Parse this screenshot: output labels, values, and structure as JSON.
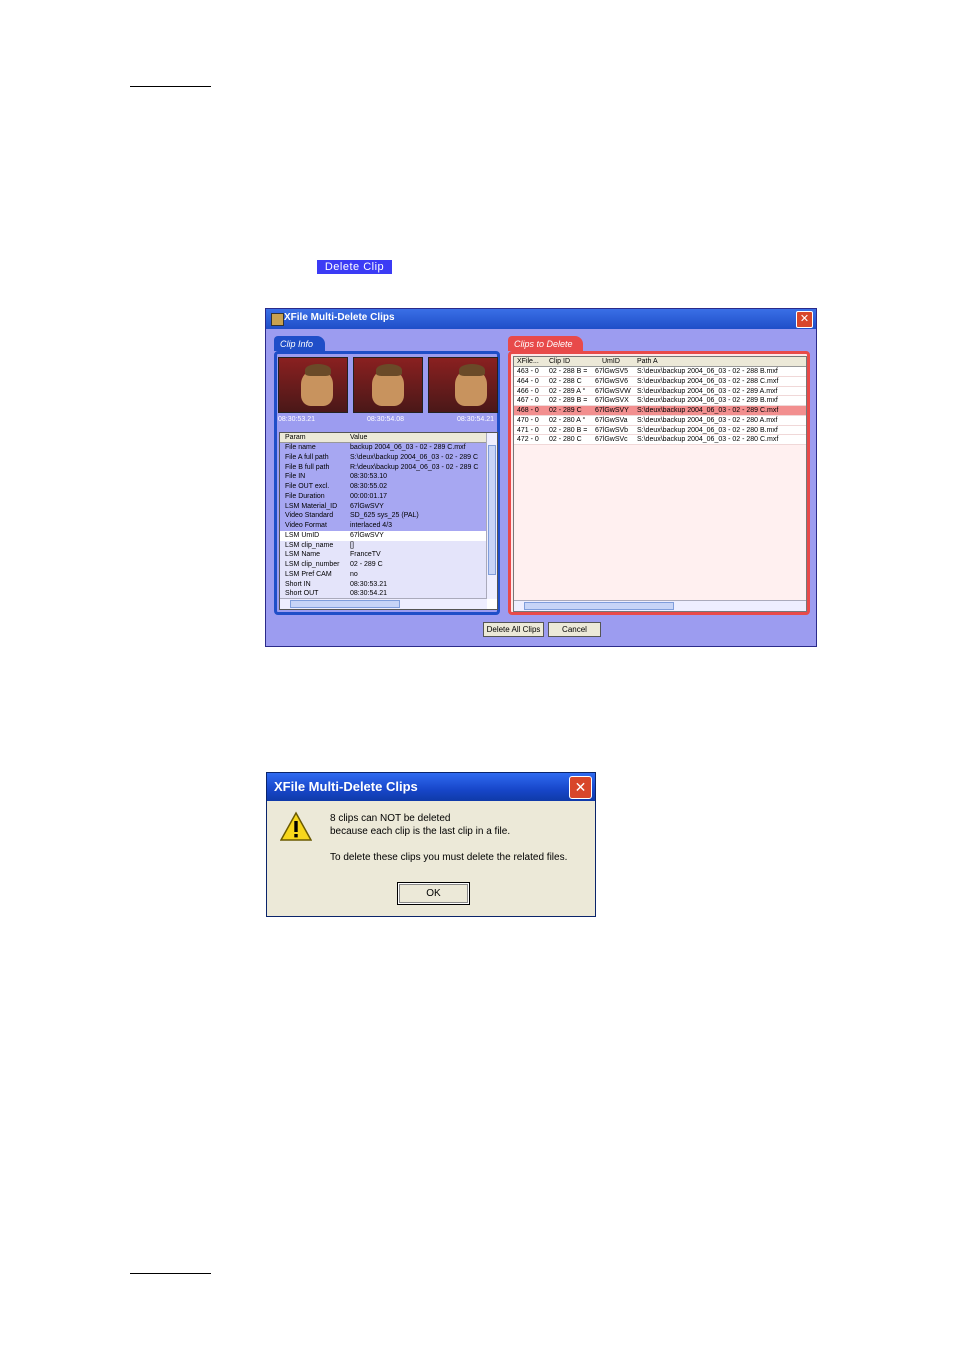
{
  "inline_button": {
    "label": "Delete Clip"
  },
  "main_window": {
    "title": "XFile Multi-Delete Clips",
    "clip_info": {
      "tab": "Clip Info",
      "timecodes": [
        "08:30:53.21",
        "08:30:54.08",
        "08:30:54.21"
      ],
      "columns": [
        "Param",
        "Value"
      ],
      "rows": [
        {
          "param": "File name",
          "value": "backup 2004_06_03 - 02 - 289 C.mxf"
        },
        {
          "param": "File A full path",
          "value": "S:\\deux\\backup 2004_06_03 - 02 - 289 C"
        },
        {
          "param": "File B full path",
          "value": "R:\\deux\\backup 2004_06_03 - 02 - 289 C"
        },
        {
          "param": "File IN",
          "value": "08:30:53.10"
        },
        {
          "param": "File OUT excl.",
          "value": "08:30:55.02"
        },
        {
          "param": "File Duration",
          "value": "00:00:01.17"
        },
        {
          "param": "LSM Material_ID",
          "value": "67lGwSVY"
        },
        {
          "param": "Video Standard",
          "value": "SD_625 sys_25 (PAL)"
        },
        {
          "param": "Video Format",
          "value": "interlaced 4/3"
        },
        {
          "param": "LSM UmID",
          "value": "67lGwSVY"
        },
        {
          "param": "LSM clip_name",
          "value": "[]"
        },
        {
          "param": "LSM Name",
          "value": "FranceTV"
        },
        {
          "param": "LSM clip_number",
          "value": "02 - 289 C"
        },
        {
          "param": "LSM Pref CAM",
          "value": "no"
        },
        {
          "param": "Short IN",
          "value": "08:30:53.21"
        },
        {
          "param": "Short OUT",
          "value": "08:30:54.21"
        }
      ]
    },
    "clips_to_delete": {
      "tab": "Clips to Delete",
      "columns": [
        "XFile...",
        "Clip ID",
        "UmID",
        "Path A"
      ],
      "rows": [
        {
          "xfile": "463 - 0",
          "clip_id": "02 - 288 B =",
          "umid": "67lGwSV5",
          "path": "S:\\deux\\backup 2004_06_03 - 02 - 288 B.mxf"
        },
        {
          "xfile": "464 - 0",
          "clip_id": "02 - 288 C",
          "umid": "67lGwSV6",
          "path": "S:\\deux\\backup 2004_06_03 - 02 - 288 C.mxf"
        },
        {
          "xfile": "466 - 0",
          "clip_id": "02 - 289 A °",
          "umid": "67lGwSVW",
          "path": "S:\\deux\\backup 2004_06_03 - 02 - 289 A.mxf"
        },
        {
          "xfile": "467 - 0",
          "clip_id": "02 - 289 B =",
          "umid": "67lGwSVX",
          "path": "S:\\deux\\backup 2004_06_03 - 02 - 289 B.mxf"
        },
        {
          "xfile": "468 - 0",
          "clip_id": "02 - 289 C",
          "umid": "67lGwSVY",
          "path": "S:\\deux\\backup 2004_06_03 - 02 - 289 C.mxf"
        },
        {
          "xfile": "470 - 0",
          "clip_id": "02 - 280 A °",
          "umid": "67lGwSVa",
          "path": "S:\\deux\\backup 2004_06_03 - 02 - 280 A.mxf"
        },
        {
          "xfile": "471 - 0",
          "clip_id": "02 - 280 B =",
          "umid": "67lGwSVb",
          "path": "S:\\deux\\backup 2004_06_03 - 02 - 280 B.mxf"
        },
        {
          "xfile": "472 - 0",
          "clip_id": "02 - 280 C",
          "umid": "67lGwSVc",
          "path": "S:\\deux\\backup 2004_06_03 - 02 - 280 C.mxf"
        }
      ],
      "selected_index": 4
    },
    "buttons": {
      "delete_all": "Delete All Clips",
      "cancel": "Cancel"
    }
  },
  "alert_dialog": {
    "title": "XFile Multi-Delete Clips",
    "line1": "8 clips can NOT be deleted",
    "line2": "because each clip is the last clip in a file.",
    "line3": "To delete these clips you must delete the related files.",
    "ok": "OK"
  },
  "colors": {
    "window_bg": "#9c9cf0",
    "clip_info_accent": "#1f4ec8",
    "clips_to_delete_accent": "#e84a4a",
    "selected_row": "#f28f8f",
    "inline_button_bg": "#3b3bf5"
  }
}
